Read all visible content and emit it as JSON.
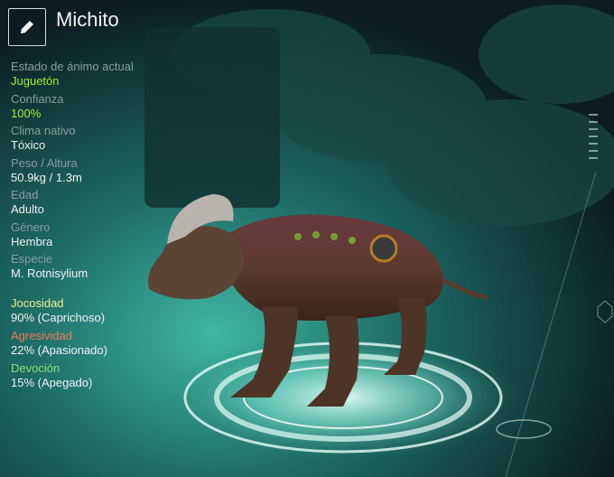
{
  "creature": {
    "name": "Michito"
  },
  "stats": [
    {
      "label": "Estado de ánimo actual",
      "value": "Juguetón"
    },
    {
      "label": "Confianza",
      "value": "100%"
    },
    {
      "label": "Clima nativo",
      "value": "Tóxico"
    },
    {
      "label": "Peso / Altura",
      "value": "50.9kg / 1.3m"
    },
    {
      "label": "Edad",
      "value": "Adulto"
    },
    {
      "label": "Género",
      "value": "Hembra"
    },
    {
      "label": "Especie",
      "value": "M. Rotnisylium"
    }
  ],
  "personality": [
    {
      "label": "Jocosidad",
      "value": "90% (Caprichoso)",
      "color": "#f3f08a"
    },
    {
      "label": "Agresividad",
      "value": "22% (Apasionado)",
      "color": "#f07a5a"
    },
    {
      "label": "Devoción",
      "value": "15% (Apegado)",
      "color": "#8fe07a"
    }
  ],
  "icons": {
    "edit": "pencil-icon"
  },
  "colors": {
    "accent_green": "#9ff03c",
    "background": "#0c1f24"
  }
}
